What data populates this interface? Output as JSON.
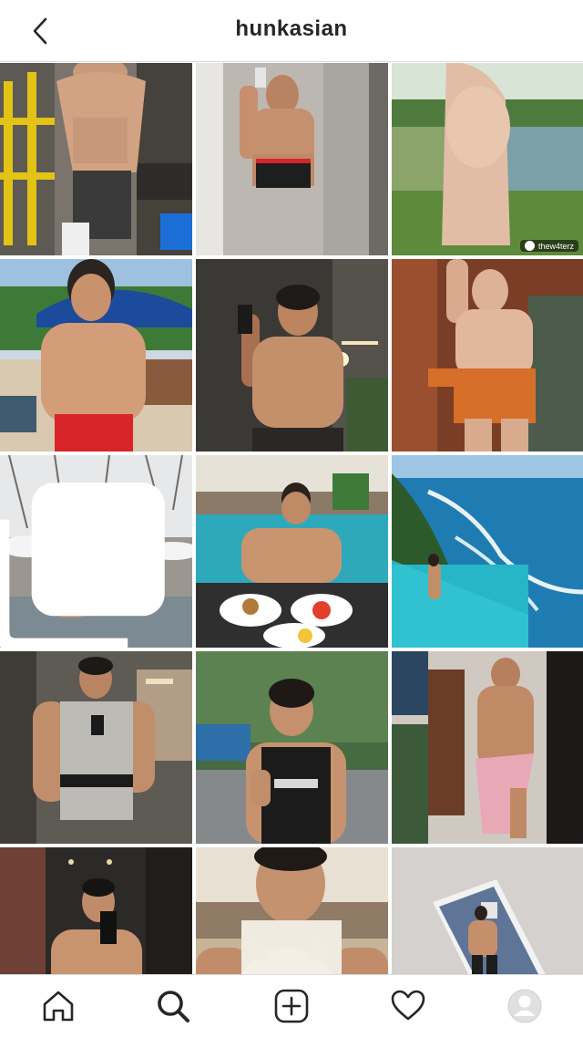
{
  "header": {
    "title": "hunkasian",
    "back_icon": "chevron-left-icon"
  },
  "grid": {
    "tiles": [
      {
        "id": 1,
        "description": "gym",
        "bg": "#6e6a63"
      },
      {
        "id": 2,
        "description": "mirror-selfie",
        "bg": "#b7b2aa"
      },
      {
        "id": 3,
        "description": "outdoor-lake",
        "bg": "#7f9a5a",
        "credit": "thew4terz"
      },
      {
        "id": 4,
        "description": "beach",
        "bg": "#b9c9d6"
      },
      {
        "id": 5,
        "description": "dark-room-selfie",
        "bg": "#3c3a36"
      },
      {
        "id": 6,
        "description": "orange-outfit",
        "bg": "#8a4a2c"
      },
      {
        "id": 7,
        "description": "snow-hot-spring",
        "bg": "#d7d9dc",
        "multi": true
      },
      {
        "id": 8,
        "description": "pool-breakfast",
        "bg": "#2aa5b8"
      },
      {
        "id": 9,
        "description": "sea-cliff-pool",
        "bg": "#1e7db4"
      },
      {
        "id": 10,
        "description": "gym-tank",
        "bg": "#5b5650"
      },
      {
        "id": 11,
        "description": "street-tank",
        "bg": "#4d6d47"
      },
      {
        "id": 12,
        "description": "towel-mirror",
        "bg": "#c9c3bb"
      },
      {
        "id": 13,
        "description": "elevator-selfie",
        "bg": "#2f2c2a"
      },
      {
        "id": 14,
        "description": "cat-selfie",
        "bg": "#a99a85"
      },
      {
        "id": 15,
        "description": "wall-mirror",
        "bg": "#d3d0cd"
      }
    ]
  },
  "bottom_nav": {
    "items": [
      {
        "name": "home-icon"
      },
      {
        "name": "search-icon",
        "active": true
      },
      {
        "name": "add-post-icon"
      },
      {
        "name": "heart-icon"
      },
      {
        "name": "profile-avatar-icon"
      }
    ]
  }
}
